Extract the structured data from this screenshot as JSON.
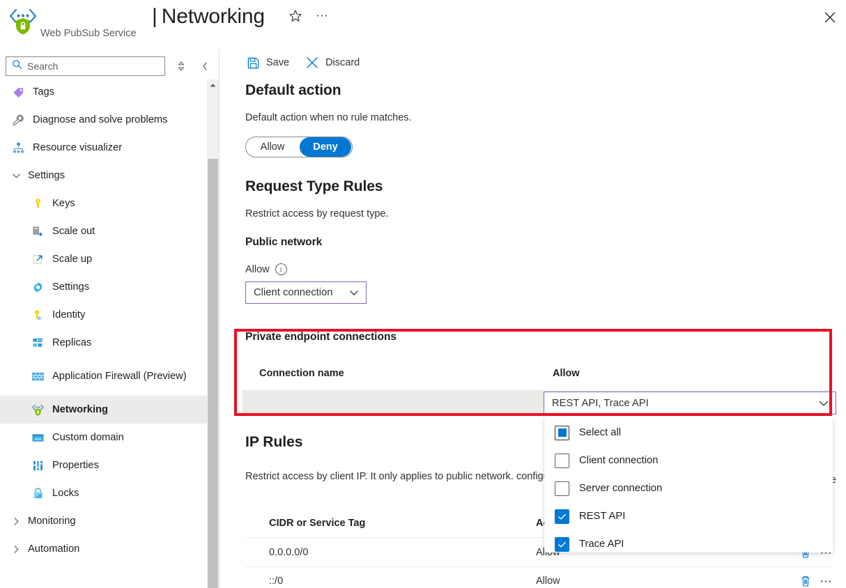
{
  "header": {
    "resource_icon": "web-pubsub-service-icon",
    "title_separator": "|",
    "title": "Networking",
    "subtitle": "Web PubSub Service",
    "favorite_icon": "star-icon",
    "more_icon": "ellipsis-icon",
    "close_icon": "close-icon"
  },
  "sidebar": {
    "search": {
      "placeholder": "Search",
      "value": "",
      "icon": "search-icon"
    },
    "sort_icon": "sort-icon",
    "collapse_icon": "double-chevron-left-icon",
    "items": [
      {
        "label": "Tags",
        "icon": "tag-icon",
        "type": "item",
        "selected": false
      },
      {
        "label": "Diagnose and solve problems",
        "icon": "wrench-icon",
        "type": "item",
        "selected": false
      },
      {
        "label": "Resource visualizer",
        "icon": "resource-visualizer-icon",
        "type": "item",
        "selected": false
      },
      {
        "label": "Settings",
        "icon": "chevron-down-icon",
        "type": "group",
        "expanded": true
      },
      {
        "label": "Keys",
        "icon": "key-icon",
        "type": "sub",
        "selected": false
      },
      {
        "label": "Scale out",
        "icon": "scale-out-icon",
        "type": "sub",
        "selected": false
      },
      {
        "label": "Scale up",
        "icon": "scale-up-icon",
        "type": "sub",
        "selected": false
      },
      {
        "label": "Settings",
        "icon": "gear-icon",
        "type": "sub",
        "selected": false
      },
      {
        "label": "Identity",
        "icon": "identity-key-icon",
        "type": "sub",
        "selected": false
      },
      {
        "label": "Replicas",
        "icon": "replicas-icon",
        "type": "sub",
        "selected": false
      },
      {
        "label": "Application Firewall (Preview)",
        "icon": "firewall-icon",
        "type": "sub-two-line",
        "selected": false
      },
      {
        "label": "Networking",
        "icon": "networking-icon",
        "type": "sub",
        "selected": true
      },
      {
        "label": "Custom domain",
        "icon": "custom-domain-icon",
        "type": "sub",
        "selected": false
      },
      {
        "label": "Properties",
        "icon": "properties-icon",
        "type": "sub",
        "selected": false
      },
      {
        "label": "Locks",
        "icon": "lock-icon",
        "type": "sub",
        "selected": false
      },
      {
        "label": "Monitoring",
        "icon": "chevron-right-icon",
        "type": "group",
        "expanded": false
      },
      {
        "label": "Automation",
        "icon": "chevron-right-icon",
        "type": "group",
        "expanded": false
      }
    ]
  },
  "commandbar": {
    "save_label": "Save",
    "save_icon": "save-disk-icon",
    "discard_label": "Discard",
    "discard_icon": "cancel-x-icon"
  },
  "default_action": {
    "heading": "Default action",
    "description": "Default action when no rule matches.",
    "options": [
      "Allow",
      "Deny"
    ],
    "selected": "Deny"
  },
  "request_type_rules": {
    "heading": "Request Type Rules",
    "description": "Restrict access by request type.",
    "public_network": {
      "subheading": "Public network",
      "field_label": "Allow",
      "info_icon": "info-circle-icon",
      "combo_value": "Client connection",
      "chevron_icon": "chevron-down-icon"
    },
    "private_endpoint": {
      "subheading": "Private endpoint connections",
      "columns": [
        "Connection name",
        "Allow"
      ],
      "rows": [
        {
          "connection_name": "",
          "allow": "REST API, Trace API"
        }
      ],
      "chevron_icon": "chevron-down-icon",
      "dropdown": {
        "options": [
          {
            "label": "Select all",
            "state": "indeterminate"
          },
          {
            "label": "Client connection",
            "state": "unchecked"
          },
          {
            "label": "Server connection",
            "state": "unchecked"
          },
          {
            "label": "REST API",
            "state": "checked"
          },
          {
            "label": "Trace API",
            "state": "checked"
          }
        ],
        "check_icon": "checkmark-icon"
      }
    }
  },
  "ip_rules": {
    "heading": "IP Rules",
    "description": "Restrict access by client IP. It only applies to public network. configured.",
    "columns": [
      "CIDR or Service Tag",
      "Action"
    ],
    "column_action_visible": "Ac",
    "rows": [
      {
        "cidr": "0.0.0.0/0",
        "action": "Allow",
        "delete_icon": "trash-icon",
        "more_icon": "ellipsis-icon"
      },
      {
        "cidr": "::/0",
        "action": "Allow",
        "delete_icon": "trash-icon",
        "more_icon": "ellipsis-icon"
      }
    ],
    "occluded_fragment": "e"
  },
  "highlight": {
    "color": "#e81123",
    "name": "private-endpoint-highlight"
  },
  "colors": {
    "accent": "#0078d4",
    "combo_border": "#8764b8",
    "selected_nav_bg": "#edebe9",
    "row_bg": "#edebe9"
  }
}
